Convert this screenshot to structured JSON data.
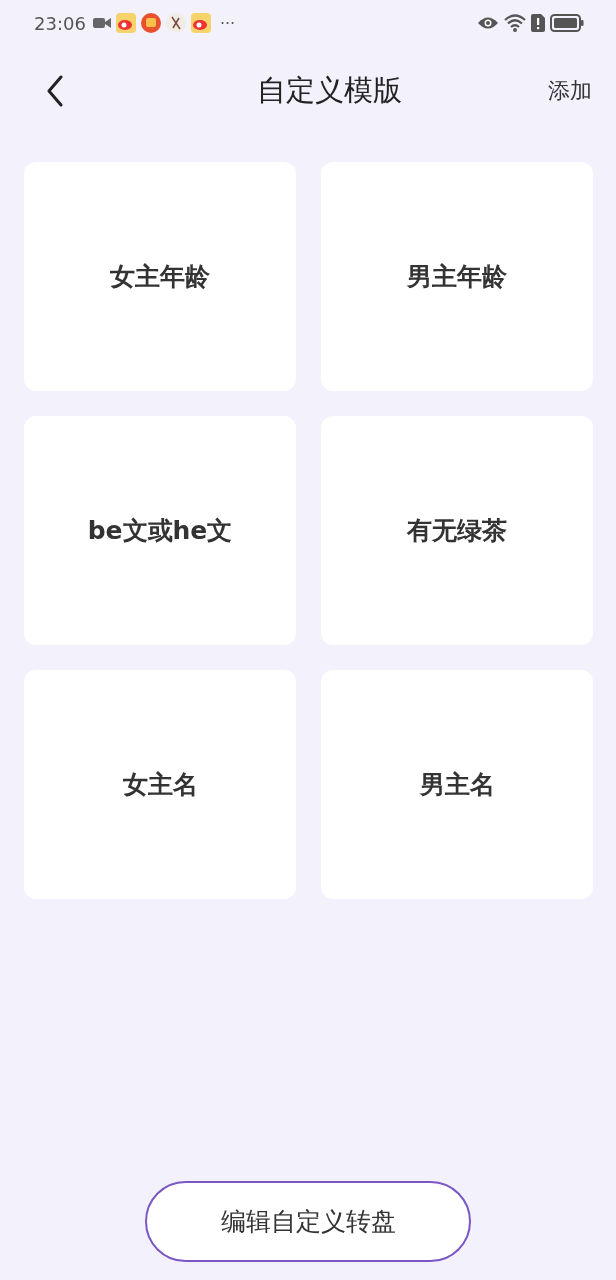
{
  "status_bar": {
    "time": "23:06",
    "more": "···"
  },
  "header": {
    "title": "自定义模版",
    "action": "添加"
  },
  "templates": [
    {
      "label": "女主年龄"
    },
    {
      "label": "男主年龄"
    },
    {
      "label": "be文或he文"
    },
    {
      "label": "有无绿茶"
    },
    {
      "label": "女主名"
    },
    {
      "label": "男主名"
    }
  ],
  "bottom_button": "编辑自定义转盘"
}
